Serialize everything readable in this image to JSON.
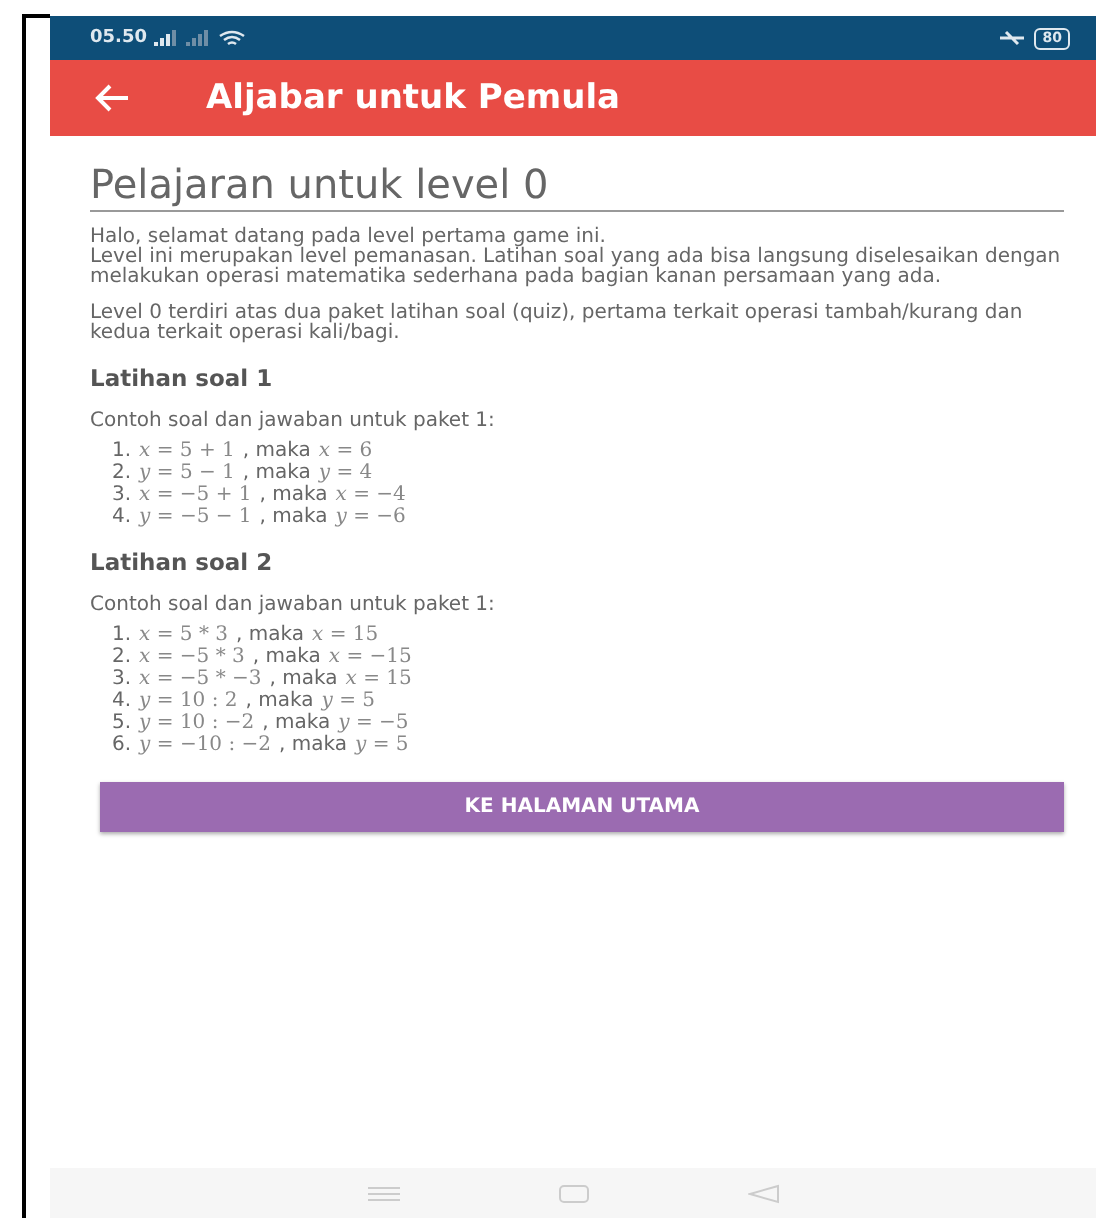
{
  "status_bar": {
    "time": "05.50",
    "battery": "80"
  },
  "app_bar": {
    "title": "Aljabar untuk Pemula"
  },
  "heading": "Pelajaran untuk level 0",
  "paragraphs": [
    "Halo, selamat datang pada level pertama game ini.\nLevel ini merupakan level pemanasan. Latihan soal yang ada bisa langsung diselesaikan dengan melakukan operasi matematika sederhana pada bagian kanan persamaan yang ada.",
    "Level 0 terdiri atas dua paket latihan soal (quiz), pertama terkait operasi tambah/kurang dan kedua terkait operasi kali/bagi."
  ],
  "sections": [
    {
      "title": "Latihan soal 1",
      "intro": "Contoh soal dan jawaban untuk paket 1:",
      "items": [
        {
          "number": "1.",
          "question": "*x* = 5 + 1",
          "connector": ", maka",
          "answer": "*x* = 6"
        },
        {
          "number": "2.",
          "question": "*y* = 5 − 1",
          "connector": ", maka",
          "answer": "*y* = 4"
        },
        {
          "number": "3.",
          "question": "*x* = −5 + 1",
          "connector": ", maka",
          "answer": "*x* = −4"
        },
        {
          "number": "4.",
          "question": "*y* = −5 − 1",
          "connector": ", maka",
          "answer": "*y* = −6"
        }
      ]
    },
    {
      "title": "Latihan soal 2",
      "intro": "Contoh soal dan jawaban untuk paket 1:",
      "items": [
        {
          "number": "1.",
          "question": "*x* = 5 * 3",
          "connector": ", maka",
          "answer": "*x* = 15"
        },
        {
          "number": "2.",
          "question": "*x* = −5 * 3",
          "connector": ", maka",
          "answer": "*x* = −15"
        },
        {
          "number": "3.",
          "question": "*x* = −5 * −3",
          "connector": ", maka",
          "answer": "*x* = 15"
        },
        {
          "number": "4.",
          "question": "*y* = 10 : 2",
          "connector": ", maka",
          "answer": "*y* = 5"
        },
        {
          "number": "5.",
          "question": "*y* = 10 : −2",
          "connector": ", maka",
          "answer": "*y* = −5"
        },
        {
          "number": "6.",
          "question": "*y* = −10 : −2",
          "connector": ", maka",
          "answer": "*y* = 5"
        }
      ]
    }
  ],
  "button": "KE HALAMAN UTAMA"
}
